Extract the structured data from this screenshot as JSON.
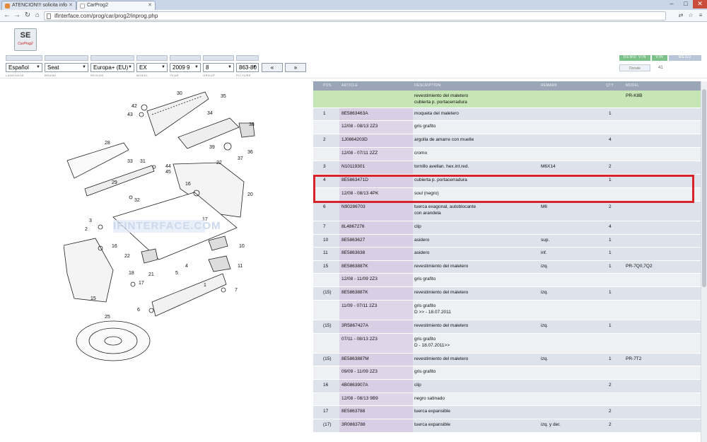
{
  "browser": {
    "tabs": [
      {
        "title": "ATENCION!!! solicita info"
      },
      {
        "title": "CarProg2"
      }
    ],
    "url": "ifinterface.com/prog/car/prog2/inprog.php"
  },
  "logo": {
    "line1": "SE",
    "line2": "CarProg2"
  },
  "header": {
    "buttons": {
      "demo_vin": "DEMO VIN",
      "vin": "VIN",
      "menu": "MENU"
    },
    "selects": {
      "language": "Español",
      "brand": "Seat",
      "region": "Europa+ (EU)",
      "model": "EX",
      "year": "2009  9",
      "group": "8",
      "picture": "863-80"
    },
    "prev": "«",
    "next": "»",
    "labels": {
      "language": "LANGUAGE",
      "brand": "BRAND",
      "region": "REGION",
      "model": "MODEL",
      "year": "YEAR",
      "group": "GROUP",
      "picture": "PICTURE"
    },
    "donate": "Donate",
    "counter": "41"
  },
  "diagram": {
    "watermark": "IFINTERFACE.COM",
    "callouts": [
      "30",
      "35",
      "42",
      "43",
      "34",
      "38",
      "36",
      "39",
      "37",
      "28",
      "31",
      "33",
      "44",
      "45",
      "22",
      "29",
      "32",
      "16",
      "20",
      "3",
      "2",
      "17",
      "10",
      "16",
      "22",
      "21",
      "11",
      "18",
      "17",
      "1",
      "4",
      "5",
      "7",
      "15",
      "6",
      "25"
    ]
  },
  "table": {
    "headers": {
      "pos": "POS",
      "article": "ARTICLE",
      "description": "DESCRIPTION",
      "remark": "REMARK",
      "qty": "QTY",
      "model": "MODEL"
    },
    "rows": [
      {
        "type": "cat",
        "pos": "",
        "article": "",
        "description": "revestimiento del maletero\ncubierta p. portacerradura",
        "remark": "",
        "qty": "",
        "model": "PR-K8B"
      },
      {
        "type": "a",
        "pos": "1",
        "article": "8E5863463A",
        "description": "moqueta del maletero",
        "remark": "",
        "qty": "1",
        "model": ""
      },
      {
        "type": "b",
        "pos": "",
        "article": "12/08 - 08/13  2Z3",
        "description": "gris grafito",
        "remark": "",
        "qty": "",
        "model": ""
      },
      {
        "type": "a",
        "pos": "2",
        "article": "1J0864203D",
        "description": "argolla de amarre con muelle",
        "remark": "",
        "qty": "4",
        "model": ""
      },
      {
        "type": "b",
        "pos": "",
        "article": "12/08 - 07/11  2ZZ",
        "description": "cromo",
        "remark": "",
        "qty": "",
        "model": ""
      },
      {
        "type": "a",
        "pos": "3",
        "article": "N10119301",
        "description": "tornillo avellan. hex.int.red.",
        "remark": "M6X14",
        "qty": "2",
        "model": ""
      },
      {
        "type": "a",
        "pos": "4",
        "article": "8E5863471D",
        "description": "cubierta p. portacerradura",
        "remark": "",
        "qty": "1",
        "model": ""
      },
      {
        "type": "b",
        "pos": "",
        "article": "12/08 - 08/13  4PK",
        "description": "soul (negro)",
        "remark": "",
        "qty": "",
        "model": ""
      },
      {
        "type": "a",
        "pos": "6",
        "article": "N90286703",
        "description": "tuerca exagonal, autoblocante\ncon arandela",
        "remark": "M6",
        "qty": "2",
        "model": ""
      },
      {
        "type": "a",
        "pos": "7",
        "article": "8L4867276",
        "description": "clip",
        "remark": "",
        "qty": "4",
        "model": ""
      },
      {
        "type": "a",
        "pos": "10",
        "article": "8E5863627",
        "description": "asidero",
        "remark": "sup.",
        "qty": "1",
        "model": ""
      },
      {
        "type": "a",
        "pos": "11",
        "article": "8E5863638",
        "description": "asidero",
        "remark": "inf.",
        "qty": "1",
        "model": ""
      },
      {
        "type": "a",
        "pos": "15",
        "article": "8E5863887K",
        "description": "revestimiento del maletero",
        "remark": "izq.",
        "qty": "1",
        "model": "PR-7Q0,7Q2"
      },
      {
        "type": "b",
        "pos": "",
        "article": "12/08 - 11/09  2Z3",
        "description": "gris grafito",
        "remark": "",
        "qty": "",
        "model": ""
      },
      {
        "type": "a",
        "pos": "(15)",
        "article": "8E5863887K",
        "description": "revestimiento del maletero",
        "remark": "izq.",
        "qty": "1",
        "model": ""
      },
      {
        "type": "b",
        "pos": "",
        "article": "11/09 - 07/11  2Z3",
        "description": "gris grafito\nD            >> - 18.07.2011",
        "remark": "",
        "qty": "",
        "model": ""
      },
      {
        "type": "a",
        "pos": "(15)",
        "article": "3R5867427A",
        "description": "revestimiento del maletero",
        "remark": "izq.",
        "qty": "1",
        "model": ""
      },
      {
        "type": "b",
        "pos": "",
        "article": "07/11 - 08/13  2Z3",
        "description": "gris grafito\nD - 18.07.2011>>",
        "remark": "",
        "qty": "",
        "model": ""
      },
      {
        "type": "a",
        "pos": "(15)",
        "article": "8E5863887M",
        "description": "revestimiento del maletero",
        "remark": "izq.",
        "qty": "1",
        "model": "PR-7T2"
      },
      {
        "type": "b",
        "pos": "",
        "article": "09/09 - 11/09  2Z3",
        "description": "gris grafito",
        "remark": "",
        "qty": "",
        "model": ""
      },
      {
        "type": "a",
        "pos": "16",
        "article": "4B0863907A",
        "description": "clip",
        "remark": "",
        "qty": "2",
        "model": ""
      },
      {
        "type": "b",
        "pos": "",
        "article": "12/08 - 08/13  9B9",
        "description": "negro satinado",
        "remark": "",
        "qty": "",
        "model": ""
      },
      {
        "type": "a",
        "pos": "17",
        "article": "8E5863788",
        "description": "tuerca expansible",
        "remark": "",
        "qty": "2",
        "model": ""
      },
      {
        "type": "a",
        "pos": "(17)",
        "article": "3R0863788",
        "description": "tuerca expansible",
        "remark": "izq. y der.",
        "qty": "2",
        "model": ""
      }
    ]
  }
}
